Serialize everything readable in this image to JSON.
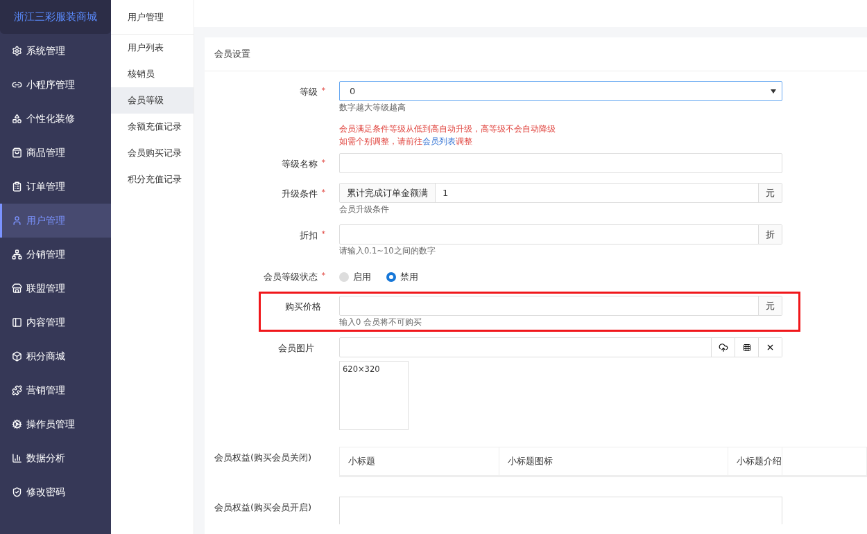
{
  "brand": "浙江三彩服装商城",
  "sidebar": {
    "items": [
      {
        "label": "系统管理",
        "selected": false
      },
      {
        "label": "小程序管理",
        "selected": false
      },
      {
        "label": "个性化装修",
        "selected": false
      },
      {
        "label": "商品管理",
        "selected": false
      },
      {
        "label": "订单管理",
        "selected": false
      },
      {
        "label": "用户管理",
        "selected": true
      },
      {
        "label": "分销管理",
        "selected": false
      },
      {
        "label": "联盟管理",
        "selected": false
      },
      {
        "label": "内容管理",
        "selected": false
      },
      {
        "label": "积分商城",
        "selected": false
      },
      {
        "label": "营销管理",
        "selected": false
      },
      {
        "label": "操作员管理",
        "selected": false
      },
      {
        "label": "数据分析",
        "selected": false
      },
      {
        "label": "修改密码",
        "selected": false
      }
    ]
  },
  "submenu": {
    "title": "用户管理",
    "items": [
      {
        "label": "用户列表",
        "selected": false
      },
      {
        "label": "核销员",
        "selected": false
      },
      {
        "label": "会员等级",
        "selected": true
      },
      {
        "label": "余额充值记录",
        "selected": false
      },
      {
        "label": "会员购买记录",
        "selected": false
      },
      {
        "label": "积分充值记录",
        "selected": false
      }
    ]
  },
  "card": {
    "title": "会员设置"
  },
  "form": {
    "level": {
      "label": "等级",
      "required_mark": "*",
      "value": "0",
      "hint": "数字越大等级越高",
      "notes": [
        "会员满足条件等级从低到高自动升级，高等级不会自动降级"
      ],
      "note2_before": "如需个别调整，请前往",
      "note2_link": "会员列表",
      "note2_after": "调整"
    },
    "name": {
      "label": "等级名称",
      "required_mark": "*"
    },
    "upgrade": {
      "label": "升级条件",
      "required_mark": "*",
      "prefix": "累计完成订单金额满",
      "value": "1",
      "suffix": "元",
      "hint": "会员升级条件"
    },
    "discount": {
      "label": "折扣",
      "required_mark": "*",
      "suffix": "折",
      "hint": "请输入0.1~10之间的数字"
    },
    "status": {
      "label": "会员等级状态",
      "required_mark": "*",
      "options": [
        {
          "label": "启用",
          "selected": false
        },
        {
          "label": "禁用",
          "selected": true
        }
      ]
    },
    "price": {
      "label": "购买价格",
      "highlighted": true,
      "suffix": "元",
      "hint": "输入0 会员将不可购买"
    },
    "image": {
      "label": "会员图片",
      "size": "620×320"
    },
    "benefits_closed": {
      "label": "会员权益(购买会员关闭)",
      "columns": [
        "小标题",
        "小标题图标",
        "小标题介绍"
      ]
    },
    "benefits_open": {
      "label": "会员权益(购买会员开启)"
    }
  }
}
